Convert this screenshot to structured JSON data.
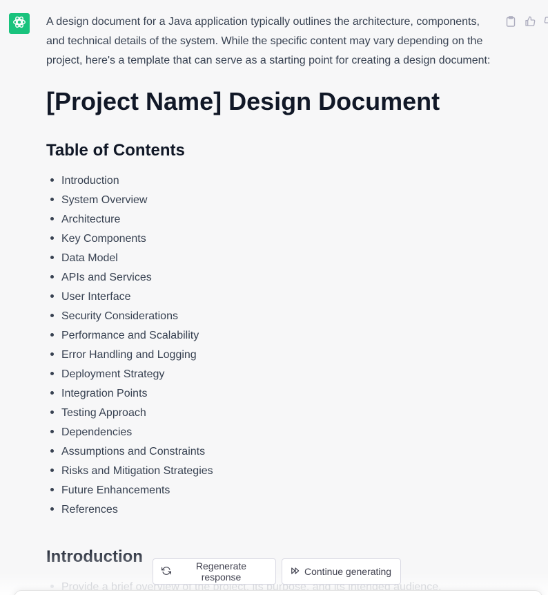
{
  "colors": {
    "accent": "#19c37d",
    "background": "#f7f7f8",
    "heading": "#111827",
    "text": "#374151"
  },
  "assistant": {
    "avatar_icon": "openai-logo-icon"
  },
  "message_actions": [
    {
      "icon": "clipboard-icon"
    },
    {
      "icon": "thumbs-up-icon"
    },
    {
      "icon": "thumbs-down-icon"
    }
  ],
  "message": {
    "intro": "A design document for a Java application typically outlines the architecture, components, and technical details of the system. While the specific content may vary depending on the project, here's a template that can serve as a starting point for creating a design document:",
    "doc_title": "[Project Name] Design Document",
    "toc_title": "Table of Contents",
    "toc_items": [
      "Introduction",
      "System Overview",
      "Architecture",
      "Key Components",
      "Data Model",
      "APIs and Services",
      "User Interface",
      "Security Considerations",
      "Performance and Scalability",
      "Error Handling and Logging",
      "Deployment Strategy",
      "Integration Points",
      "Testing Approach",
      "Dependencies",
      "Assumptions and Constraints",
      "Risks and Mitigation Strategies",
      "Future Enhancements",
      "References"
    ],
    "section_title": "Introduction",
    "section_items": [
      "Provide a brief overview of the project, its purpose, and its intended audience."
    ]
  },
  "controls": {
    "regenerate_label": "Regenerate response",
    "regenerate_icon": "refresh-icon",
    "continue_label": "Continue generating",
    "continue_icon": "fast-forward-icon"
  }
}
